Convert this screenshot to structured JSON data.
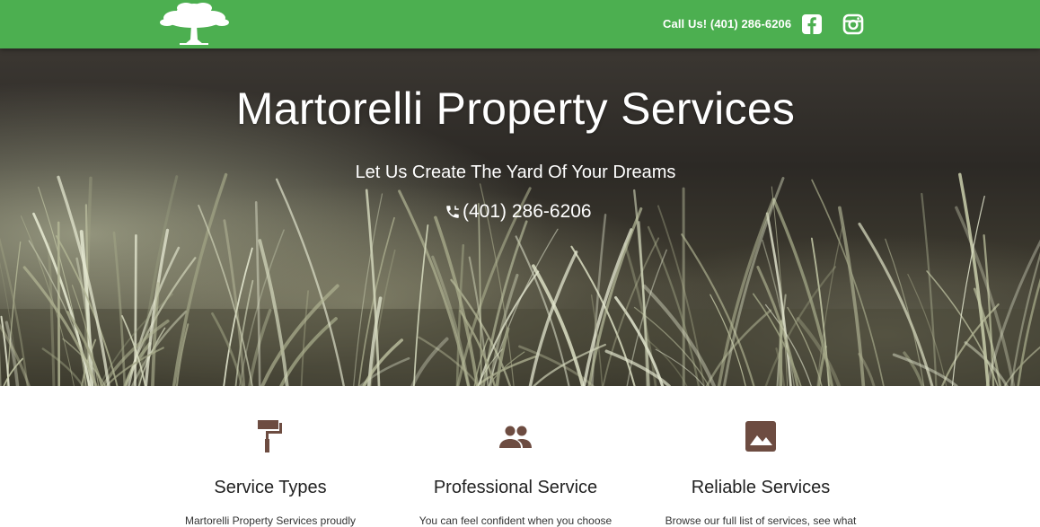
{
  "header": {
    "call_text": "Call Us! (401) 286-6206",
    "icons": [
      "tree-logo-icon",
      "facebook-icon",
      "instagram-icon"
    ],
    "brand_color": "#4caf50"
  },
  "hero": {
    "title": "Martorelli Property Services",
    "subtitle": "Let Us Create The Yard Of Your Dreams",
    "phone": "(401) 286-6206",
    "phone_icon": "phone-icon"
  },
  "features": [
    {
      "icon": "paint-roller-icon",
      "title": "Service Types",
      "desc": "Martorelli Property Services proudly"
    },
    {
      "icon": "people-icon",
      "title": "Professional Service",
      "desc": "You can feel confident when you choose"
    },
    {
      "icon": "image-icon",
      "title": "Reliable Services",
      "desc": "Browse our full list of services, see what"
    }
  ],
  "icon_color": "#6d4c41"
}
